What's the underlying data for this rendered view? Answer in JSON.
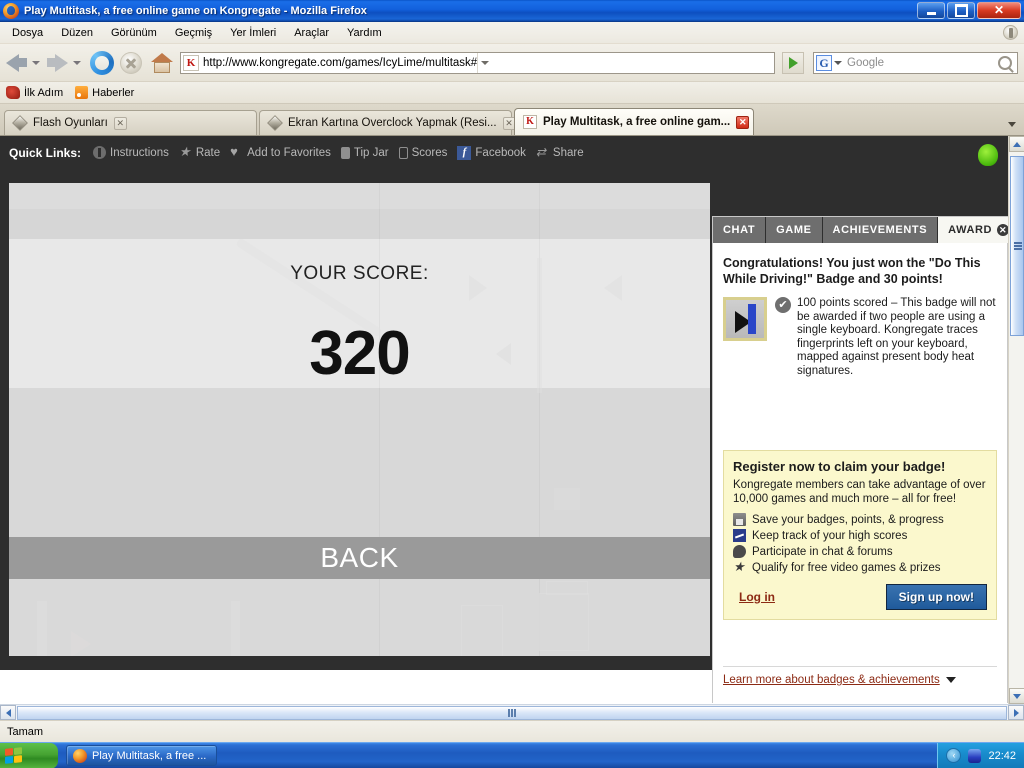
{
  "window": {
    "title": "Play Multitask, a free online game on Kongregate - Mozilla Firefox",
    "minimize_label": "Minimize",
    "restore_label": "Restore",
    "close_label": "Close"
  },
  "menubar": [
    {
      "label": "Dosya"
    },
    {
      "label": "Düzen"
    },
    {
      "label": "Görünüm"
    },
    {
      "label": "Geçmiş"
    },
    {
      "label": "Yer İmleri"
    },
    {
      "label": "Araçlar"
    },
    {
      "label": "Yardım"
    }
  ],
  "navbar": {
    "url": "http://www.kongregate.com/games/IcyLime/multitask#",
    "search_placeholder": "Google",
    "back_label": "Geri",
    "forward_label": "İleri",
    "reload_label": "Yeniden Yükle",
    "stop_label": "Dur",
    "home_label": "Giriş"
  },
  "bookmarks": [
    {
      "label": "İlk Adım",
      "icon": "firefox-bookmark-icon"
    },
    {
      "label": "Haberler",
      "icon": "rss-icon"
    }
  ],
  "tabs": [
    {
      "label": "Flash Oyunları",
      "active": false
    },
    {
      "label": "Ekran Kartına Overclock Yapmak (Resi...",
      "active": false
    },
    {
      "label": "Play Multitask, a free online gam...",
      "active": true,
      "favicon_text": "K"
    }
  ],
  "quick_links": {
    "title": "Quick Links:",
    "items": [
      {
        "label": "Instructions",
        "icon": "instructions-icon"
      },
      {
        "label": "Rate",
        "icon": "star-icon"
      },
      {
        "label": "Add to Favorites",
        "icon": "heart-icon"
      },
      {
        "label": "Tip Jar",
        "icon": "tip-jar-icon"
      },
      {
        "label": "Scores",
        "icon": "scores-icon"
      },
      {
        "label": "Facebook",
        "icon": "facebook-icon"
      },
      {
        "label": "Share",
        "icon": "share-icon"
      }
    ]
  },
  "game": {
    "watermark_score": "320",
    "score_label": "YOUR SCORE:",
    "score_value": "320",
    "back_label": "BACK"
  },
  "panel": {
    "tabs": [
      {
        "label": "CHAT",
        "active": false
      },
      {
        "label": "GAME",
        "active": false
      },
      {
        "label": "ACHIEVEMENTS",
        "active": false
      },
      {
        "label": "AWARD",
        "active": true,
        "closable": true
      }
    ],
    "congrats": "Congratulations! You just won the \"Do This While Driving!\" Badge and 30 points!",
    "badge": {
      "icon": "play-badge-icon",
      "check_icon": "check-icon",
      "description": "100 points scored – This badge will not be awarded if two people are using a single keyboard. Kongregate traces fingerprints left on your keyboard, mapped against present body heat signatures."
    },
    "register": {
      "title": "Register now to claim your badge!",
      "subtitle": "Kongregate members can take advantage of over 10,000 games and much more – all for free!",
      "benefits": [
        {
          "label": "Save your badges, points, & progress",
          "icon": "save-icon"
        },
        {
          "label": "Keep track of your high scores",
          "icon": "chart-icon"
        },
        {
          "label": "Participate in chat & forums",
          "icon": "chat-bubble-icon"
        },
        {
          "label": "Qualify for free video games & prizes",
          "icon": "star-icon"
        }
      ],
      "login_label": "Log in",
      "signup_label": "Sign up now!"
    },
    "learn_more_label": "Learn more about badges & achievements"
  },
  "statusbar": {
    "text": "Tamam"
  },
  "taskbar": {
    "start_label": "",
    "items": [
      {
        "label": "Play Multitask, a free ..."
      }
    ],
    "clock": "22:42"
  },
  "colors": {
    "accent_blue": "#1d5fc4",
    "kong_dark": "#2e2e2e",
    "badge_yellow": "#fbf8cd",
    "link_red": "#8c2a14",
    "signup_blue": "#1f5a9b"
  }
}
